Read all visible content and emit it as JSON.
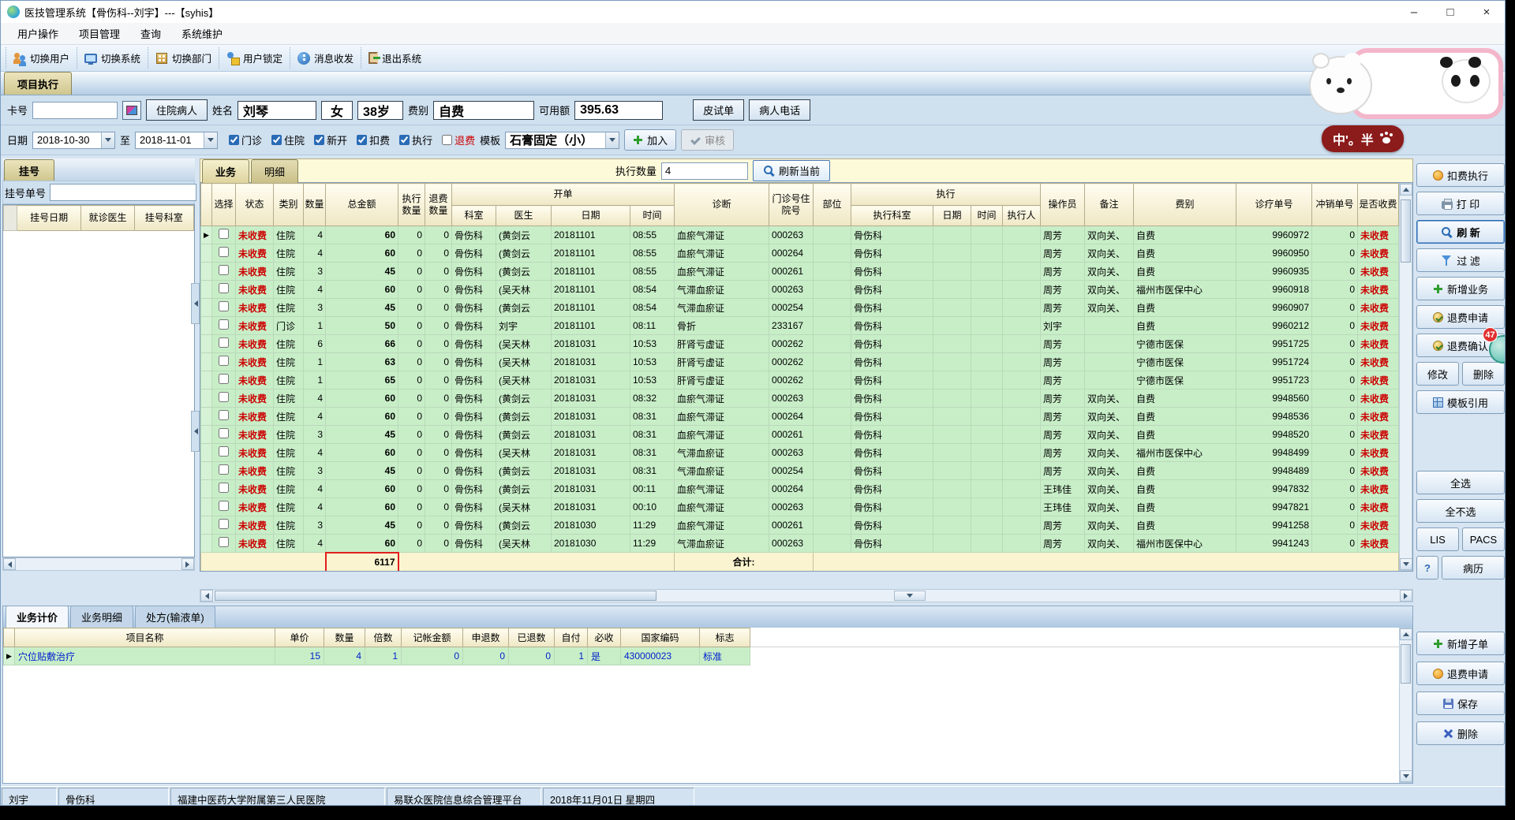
{
  "window": {
    "title": "医技管理系统【骨伤科--刘宇】---【syhis】",
    "controls": {
      "min": "–",
      "max": "□",
      "close": "×"
    }
  },
  "menu": {
    "items": [
      "用户操作",
      "项目管理",
      "查询",
      "系统维护"
    ]
  },
  "toolbar": {
    "items": [
      {
        "icon": "switch-user-icon",
        "label": "切换用户"
      },
      {
        "icon": "switch-system-icon",
        "label": "切换系统"
      },
      {
        "icon": "switch-dept-icon",
        "label": "切换部门"
      },
      {
        "icon": "user-lock-icon",
        "label": "用户锁定"
      },
      {
        "icon": "message-icon",
        "label": "消息收发"
      },
      {
        "icon": "exit-icon",
        "label": "退出系统"
      }
    ]
  },
  "page_tab": "项目执行",
  "patient": {
    "card_label": "卡号",
    "card_value": "",
    "inpatient_btn": "住院病人",
    "name_label": "姓名",
    "name": "刘琴",
    "gender": "女",
    "age": "38岁",
    "fee_label": "费别",
    "fee": "自费",
    "credit_label": "可用额",
    "credit": "395.63",
    "skin_btn": "皮试单",
    "phone_btn": "病人电话"
  },
  "filter": {
    "date_label": "日期",
    "from": "2018-10-30",
    "to_label": "至",
    "to": "2018-11-01",
    "checks": [
      {
        "label": "门诊",
        "checked": true
      },
      {
        "label": "住院",
        "checked": true
      },
      {
        "label": "新开",
        "checked": true
      },
      {
        "label": "扣费",
        "checked": true
      },
      {
        "label": "执行",
        "checked": true
      },
      {
        "label": "退费",
        "checked": false,
        "cls": "red"
      }
    ],
    "template_label": "模板",
    "template": "石膏固定（小）",
    "add_btn": "加入",
    "audit_btn": "审核"
  },
  "left": {
    "tab": "挂号",
    "regno_label": "挂号单号",
    "cols": [
      "挂号日期",
      "就诊医生",
      "挂号科室"
    ]
  },
  "grid_tabs": {
    "biz": "业务",
    "detail": "明细",
    "qty_label": "执行数量",
    "qty": "4",
    "refresh": "刷新当前"
  },
  "grid": {
    "h": {
      "select": "选择",
      "status": "状态",
      "type": "类别",
      "qty": "数量",
      "amount": "总金额",
      "exec_qty": "执行数量",
      "refund_qty": "退费数量",
      "order_group": "开单",
      "dept": "科室",
      "doctor": "医生",
      "date": "日期",
      "time": "时间",
      "diagnosis": "诊断",
      "visit_no": "门诊号住院号",
      "part": "部位",
      "exec_group": "执行",
      "exec_dept": "执行科室",
      "exec_date": "日期",
      "exec_time": "时间",
      "executor": "执行人",
      "operator": "操作员",
      "remark": "备注",
      "fee": "费别",
      "order_no": "诊疗单号",
      "reverse_no": "冲销单号",
      "charged": "是否收费"
    },
    "rows": [
      [
        "未收费",
        "住院",
        "4",
        "60",
        "0",
        "0",
        "骨伤科",
        "(黄剑云",
        "20181101",
        "08:55",
        "血瘀气滞证",
        "000263",
        "",
        "骨伤科",
        "",
        "",
        "",
        "周芳",
        "双向关、",
        "自费",
        "9960972",
        "0",
        "未收费"
      ],
      [
        "未收费",
        "住院",
        "4",
        "60",
        "0",
        "0",
        "骨伤科",
        "(黄剑云",
        "20181101",
        "08:55",
        "血瘀气滞证",
        "000264",
        "",
        "骨伤科",
        "",
        "",
        "",
        "周芳",
        "双向关、",
        "自费",
        "9960950",
        "0",
        "未收费"
      ],
      [
        "未收费",
        "住院",
        "3",
        "45",
        "0",
        "0",
        "骨伤科",
        "(黄剑云",
        "20181101",
        "08:55",
        "血瘀气滞证",
        "000261",
        "",
        "骨伤科",
        "",
        "",
        "",
        "周芳",
        "双向关、",
        "自费",
        "9960935",
        "0",
        "未收费"
      ],
      [
        "未收费",
        "住院",
        "4",
        "60",
        "0",
        "0",
        "骨伤科",
        "(吴天林",
        "20181101",
        "08:54",
        "气滞血瘀证",
        "000263",
        "",
        "骨伤科",
        "",
        "",
        "",
        "周芳",
        "双向关、",
        "福州市医保中心",
        "9960918",
        "0",
        "未收费"
      ],
      [
        "未收费",
        "住院",
        "3",
        "45",
        "0",
        "0",
        "骨伤科",
        "(黄剑云",
        "20181101",
        "08:54",
        "气滞血瘀证",
        "000254",
        "",
        "骨伤科",
        "",
        "",
        "",
        "周芳",
        "双向关、",
        "自费",
        "9960907",
        "0",
        "未收费"
      ],
      [
        "未收费",
        "门诊",
        "1",
        "50",
        "0",
        "0",
        "骨伤科",
        "刘宇",
        "20181101",
        "08:11",
        "骨折",
        "233167",
        "",
        "骨伤科",
        "",
        "",
        "",
        "刘宇",
        "",
        "自费",
        "9960212",
        "0",
        "未收费"
      ],
      [
        "未收费",
        "住院",
        "6",
        "66",
        "0",
        "0",
        "骨伤科",
        "(吴天林",
        "20181031",
        "10:53",
        "肝肾亏虚证",
        "000262",
        "",
        "骨伤科",
        "",
        "",
        "",
        "周芳",
        "",
        "宁德市医保",
        "9951725",
        "0",
        "未收费"
      ],
      [
        "未收费",
        "住院",
        "1",
        "63",
        "0",
        "0",
        "骨伤科",
        "(吴天林",
        "20181031",
        "10:53",
        "肝肾亏虚证",
        "000262",
        "",
        "骨伤科",
        "",
        "",
        "",
        "周芳",
        "",
        "宁德市医保",
        "9951724",
        "0",
        "未收费"
      ],
      [
        "未收费",
        "住院",
        "1",
        "65",
        "0",
        "0",
        "骨伤科",
        "(吴天林",
        "20181031",
        "10:53",
        "肝肾亏虚证",
        "000262",
        "",
        "骨伤科",
        "",
        "",
        "",
        "周芳",
        "",
        "宁德市医保",
        "9951723",
        "0",
        "未收费"
      ],
      [
        "未收费",
        "住院",
        "4",
        "60",
        "0",
        "0",
        "骨伤科",
        "(黄剑云",
        "20181031",
        "08:32",
        "血瘀气滞证",
        "000263",
        "",
        "骨伤科",
        "",
        "",
        "",
        "周芳",
        "双向关、",
        "自费",
        "9948560",
        "0",
        "未收费"
      ],
      [
        "未收费",
        "住院",
        "4",
        "60",
        "0",
        "0",
        "骨伤科",
        "(黄剑云",
        "20181031",
        "08:31",
        "血瘀气滞证",
        "000264",
        "",
        "骨伤科",
        "",
        "",
        "",
        "周芳",
        "双向关、",
        "自费",
        "9948536",
        "0",
        "未收费"
      ],
      [
        "未收费",
        "住院",
        "3",
        "45",
        "0",
        "0",
        "骨伤科",
        "(黄剑云",
        "20181031",
        "08:31",
        "血瘀气滞证",
        "000261",
        "",
        "骨伤科",
        "",
        "",
        "",
        "周芳",
        "双向关、",
        "自费",
        "9948520",
        "0",
        "未收费"
      ],
      [
        "未收费",
        "住院",
        "4",
        "60",
        "0",
        "0",
        "骨伤科",
        "(吴天林",
        "20181031",
        "08:31",
        "气滞血瘀证",
        "000263",
        "",
        "骨伤科",
        "",
        "",
        "",
        "周芳",
        "双向关、",
        "福州市医保中心",
        "9948499",
        "0",
        "未收费"
      ],
      [
        "未收费",
        "住院",
        "3",
        "45",
        "0",
        "0",
        "骨伤科",
        "(黄剑云",
        "20181031",
        "08:31",
        "气滞血瘀证",
        "000254",
        "",
        "骨伤科",
        "",
        "",
        "",
        "周芳",
        "双向关、",
        "自费",
        "9948489",
        "0",
        "未收费"
      ],
      [
        "未收费",
        "住院",
        "4",
        "60",
        "0",
        "0",
        "骨伤科",
        "(黄剑云",
        "20181031",
        "00:11",
        "血瘀气滞证",
        "000264",
        "",
        "骨伤科",
        "",
        "",
        "",
        "王玮佳",
        "双向关、",
        "自费",
        "9947832",
        "0",
        "未收费"
      ],
      [
        "未收费",
        "住院",
        "4",
        "60",
        "0",
        "0",
        "骨伤科",
        "(吴天林",
        "20181031",
        "00:10",
        "血瘀气滞证",
        "000263",
        "",
        "骨伤科",
        "",
        "",
        "",
        "王玮佳",
        "双向关、",
        "自费",
        "9947821",
        "0",
        "未收费"
      ],
      [
        "未收费",
        "住院",
        "3",
        "45",
        "0",
        "0",
        "骨伤科",
        "(黄剑云",
        "20181030",
        "11:29",
        "血瘀气滞证",
        "000261",
        "",
        "骨伤科",
        "",
        "",
        "",
        "周芳",
        "双向关、",
        "自费",
        "9941258",
        "0",
        "未收费"
      ],
      [
        "未收费",
        "住院",
        "4",
        "60",
        "0",
        "0",
        "骨伤科",
        "(吴天林",
        "20181030",
        "11:29",
        "气滞血瘀证",
        "000263",
        "",
        "骨伤科",
        "",
        "",
        "",
        "周芳",
        "双向关、",
        "福州市医保中心",
        "9941243",
        "0",
        "未收费"
      ]
    ],
    "total": "6117",
    "total_label": "合计:"
  },
  "right_panel": {
    "deduct": "扣费执行",
    "print": "打 印",
    "refresh": "刷 新",
    "filter": "过 滤",
    "new_biz": "新增业务",
    "refund_apply": "退费申请",
    "refund_confirm": "退费确认",
    "modify": "修改",
    "delete": "删除",
    "template_ref": "模板引用",
    "select_all": "全选",
    "select_none": "全不选",
    "lis": "LIS",
    "pacs": "PACS",
    "question": "?",
    "record": "病历"
  },
  "bottom": {
    "tabs": [
      "业务计价",
      "业务明细",
      "处方(输液单)"
    ],
    "cols": [
      "项目名称",
      "单价",
      "数量",
      "倍数",
      "记帐金额",
      "申退数",
      "已退数",
      "自付",
      "必收",
      "国家编码",
      "标志"
    ],
    "rows": [
      [
        "穴位贴敷治疗",
        "15",
        "4",
        "1",
        "0",
        "0",
        "0",
        "1",
        "是",
        "430000023",
        "标准"
      ]
    ]
  },
  "bottom_buttons": {
    "new_sub": "新增子单",
    "refund": "退费申请",
    "save": "保存",
    "delete": "删除"
  },
  "statusbar": {
    "user": "刘宇",
    "dept": "骨伤科",
    "hospital": "福建中医药大学附属第三人民医院",
    "platform": "易联众医院信息综合管理平台",
    "date": "2018年11月01日 星期四"
  },
  "widget": {
    "ime_text": "中'。半",
    "badge": "47"
  },
  "icons": {
    "row_marker": "▶"
  }
}
